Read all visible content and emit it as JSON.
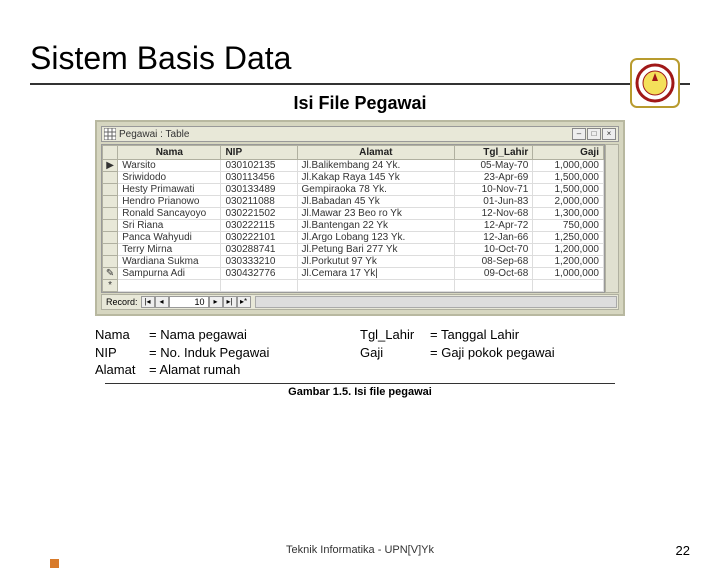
{
  "slide": {
    "title": "Sistem Basis Data",
    "subtitle": "Isi File Pegawai",
    "caption": "Gambar 1.5. Isi file pegawai",
    "footer": "Teknik Informatika - UPN[V]Yk",
    "page": "22"
  },
  "window": {
    "caption": "Pegawai : Table",
    "nav_label": "Record:",
    "nav_value": "10"
  },
  "table": {
    "headers": [
      "Nama",
      "NIP",
      "Alamat",
      "Tgl_Lahir",
      "Gaji"
    ],
    "rows": [
      {
        "sel": "▶",
        "nama": "Warsito",
        "nip": "030102135",
        "alamat": "Jl.Balikembang 24 Yk.",
        "tgl": "05-May-70",
        "gaji": "1,000,000"
      },
      {
        "sel": "",
        "nama": "Sriwidodo",
        "nip": "030113456",
        "alamat": "Jl.Kakap Raya 145 Yk",
        "tgl": "23-Apr-69",
        "gaji": "1,500,000"
      },
      {
        "sel": "",
        "nama": "Hesty Primawati",
        "nip": "030133489",
        "alamat": "Gempiraoka 78 Yk.",
        "tgl": "10-Nov-71",
        "gaji": "1,500,000"
      },
      {
        "sel": "",
        "nama": "Hendro Prianowo",
        "nip": "030211088",
        "alamat": "Jl.Babadan 45 Yk",
        "tgl": "01-Jun-83",
        "gaji": "2,000,000"
      },
      {
        "sel": "",
        "nama": "Ronald Sancayoyo",
        "nip": "030221502",
        "alamat": "Jl.Mawar 23 Beo ro Yk",
        "tgl": "12-Nov-68",
        "gaji": "1,300,000"
      },
      {
        "sel": "",
        "nama": "Sri Riana",
        "nip": "030222115",
        "alamat": "Jl.Bantengan 22 Yk",
        "tgl": "12-Apr-72",
        "gaji": "750,000"
      },
      {
        "sel": "",
        "nama": "Panca Wahyudi",
        "nip": "030222101",
        "alamat": "Jl.Argo Lobang 123 Yk.",
        "tgl": "12-Jan-66",
        "gaji": "1,250,000"
      },
      {
        "sel": "",
        "nama": "Terry Mirna",
        "nip": "030288741",
        "alamat": "Jl.Petung Bari 277 Yk",
        "tgl": "10-Oct-70",
        "gaji": "1,200,000"
      },
      {
        "sel": "",
        "nama": "Wardiana Sukma",
        "nip": "030333210",
        "alamat": "Jl.Porkutut 97 Yk",
        "tgl": "08-Sep-68",
        "gaji": "1,200,000"
      },
      {
        "sel": "✎",
        "nama": "Sampurna Adi",
        "nip": "030432776",
        "alamat": "Jl.Cemara 17 Yk|",
        "tgl": "09-Oct-68",
        "gaji": "1,000,000"
      },
      {
        "sel": "*",
        "nama": "",
        "nip": "",
        "alamat": "",
        "tgl": "",
        "gaji": ""
      }
    ]
  },
  "definitions": {
    "left": [
      {
        "k": "Nama",
        "v": "= Nama pegawai"
      },
      {
        "k": "NIP",
        "v": "= No. Induk Pegawai"
      },
      {
        "k": "Alamat",
        "v": "= Alamat rumah"
      }
    ],
    "right": [
      {
        "k": "Tgl_Lahir",
        "v": "= Tanggal Lahir"
      },
      {
        "k": "Gaji",
        "v": "= Gaji pokok pegawai"
      }
    ]
  }
}
